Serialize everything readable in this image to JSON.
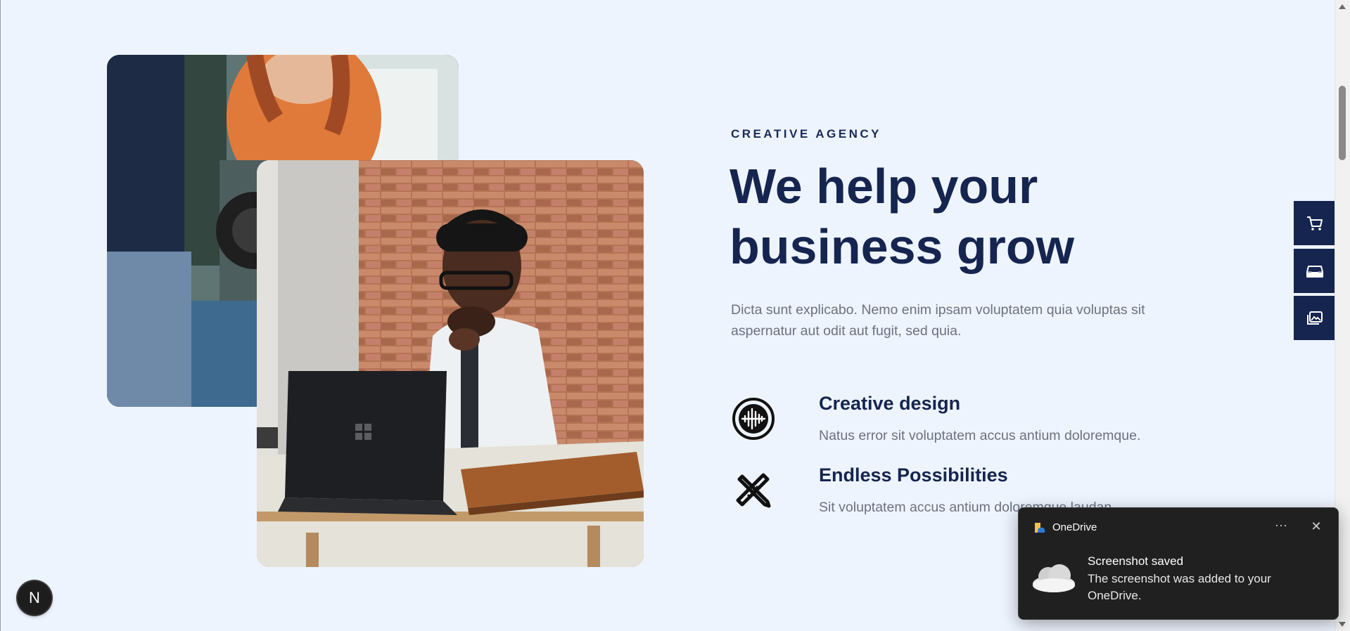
{
  "hero": {
    "eyebrow": "CREATIVE AGENCY",
    "headline_line1": "We help your",
    "headline_line2": "business grow",
    "lead": "Dicta sunt explicabo. Nemo enim ipsam voluptatem quia voluptas sit aspernatur aut odit aut fugit, sed quia."
  },
  "features": [
    {
      "icon": "circle-wave-icon",
      "title": "Creative design",
      "text": "Natus error sit voluptatem accus antium doloremque."
    },
    {
      "icon": "pencil-ruler-cross-icon",
      "title": "Endless Possibilities",
      "text": "Sit voluptatem accus antium doloremque laudan"
    }
  ],
  "side_dock": {
    "items": [
      {
        "icon": "cart-icon"
      },
      {
        "icon": "inbox-icon"
      },
      {
        "icon": "gallery-icon"
      }
    ]
  },
  "next_badge": {
    "letter": "N"
  },
  "toast": {
    "app_name": "OneDrive",
    "more": "···",
    "close": "✕",
    "title": "Screenshot saved",
    "body": "The screenshot was added to your OneDrive."
  },
  "colors": {
    "page_bg": "#eef4fe",
    "navy": "#15254f",
    "muted_text": "#6b7180",
    "toast_bg": "#202020"
  }
}
